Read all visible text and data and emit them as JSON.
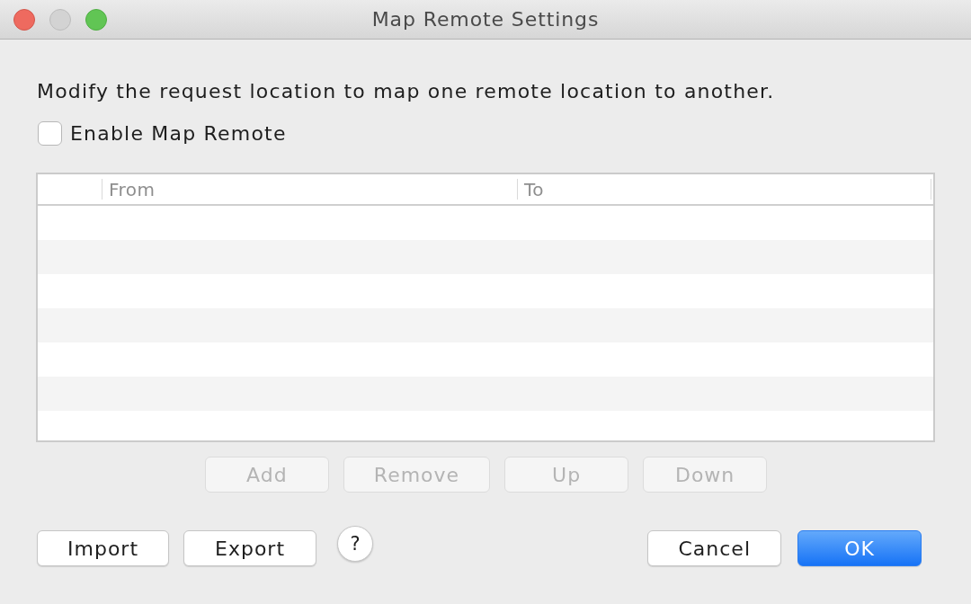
{
  "window": {
    "title": "Map Remote Settings",
    "controls": [
      {
        "kind": "close",
        "disabled": false
      },
      {
        "kind": "minimize",
        "disabled": true
      },
      {
        "kind": "zoom",
        "disabled": false
      }
    ]
  },
  "description": "Modify the request location to map one remote location to another.",
  "enable_checkbox": {
    "label": "Enable Map Remote",
    "checked": false
  },
  "table": {
    "columns": [
      "From",
      "To"
    ]
  },
  "table_buttons": [
    {
      "label": "Add",
      "disabled": true
    },
    {
      "label": "Remove",
      "disabled": true
    },
    {
      "label": "Up",
      "disabled": true
    },
    {
      "label": "Down",
      "disabled": true
    }
  ],
  "footer_left": [
    {
      "label": "Import"
    },
    {
      "label": "Export"
    }
  ],
  "help_button": {
    "label": "?"
  },
  "footer_right": [
    {
      "label": "Cancel",
      "kind": "normal"
    },
    {
      "label": "OK",
      "kind": "default"
    }
  ]
}
